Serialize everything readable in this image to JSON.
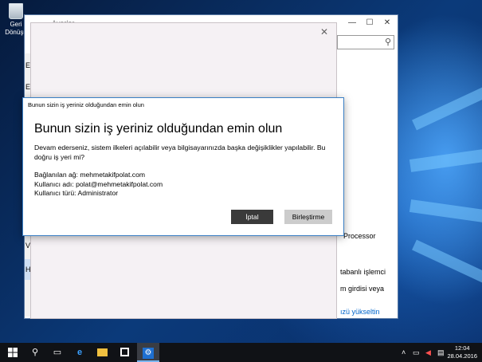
{
  "desktop": {
    "recycle_bin_label_line1": "Geri",
    "recycle_bin_label_line2": "Dönüşü"
  },
  "settings_window": {
    "title": "Ayarlar",
    "sidebar_letters": [
      "E",
      "E",
      "V",
      "H"
    ],
    "items": [
      "Processor",
      "tabanlı işlemci",
      "m girdisi veya"
    ],
    "link_text": "ızü yükseltin"
  },
  "dialog": {
    "window_title": "Bunun sizin iş yeriniz olduğundan emin olun",
    "heading": "Bunun sizin iş yeriniz olduğundan emin olun",
    "body_line1": "Devam ederseniz, sistem ilkeleri açılabilir veya bilgisayarınızda başka değişiklikler yapılabilir. Bu",
    "body_line2": "doğru iş yeri mi?",
    "network": "Bağlanılan ağ: mehmetakifpolat.com",
    "username": "Kullanıcı adı: polat@mehmetakifpolat.com",
    "usertype": "Kullanıcı türü: Administrator",
    "cancel_label": "İptal",
    "join_label": "Birleştirme"
  },
  "taskbar": {
    "clock_time": "12:04",
    "clock_date": "28.04.2016"
  },
  "colors": {
    "dialog_border": "#3a7fc4",
    "cancel_button": "#3a3a3a",
    "join_button": "#cccccc",
    "taskbar": "#101216"
  }
}
